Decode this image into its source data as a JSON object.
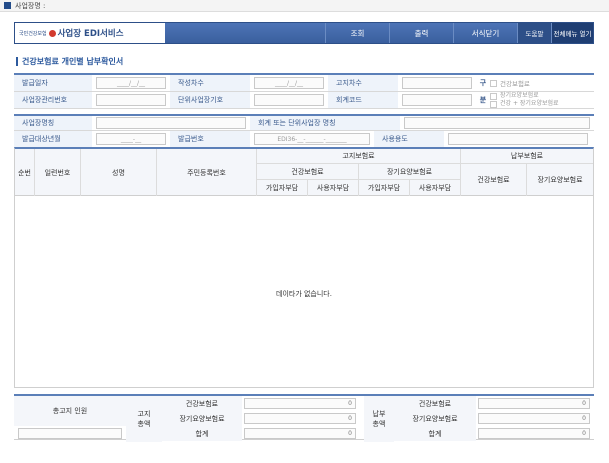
{
  "topbar": {
    "label": "사업장명 :"
  },
  "brand": {
    "org": "국민건강보험",
    "title": "사업장 EDI서비스"
  },
  "nav": {
    "query": "조회",
    "print": "출력",
    "close": "서식닫기",
    "help": "도움말",
    "allmenu": "전체메뉴 열기"
  },
  "page": {
    "title": "건강보험료 개인별 납부확인서"
  },
  "form": {
    "issue_date_label": "발급일자",
    "issue_date_value": "____/__/__",
    "write_count_label": "작성차수",
    "write_count_value": "____/__/__",
    "notice_count_label": "고지차수",
    "gu_label": "구",
    "bun_label": "분",
    "opt_health": "건강보험료",
    "opt_longterm": "장기요양보험료",
    "opt_both": "건강 + 장기요양보험료",
    "mgmt_no_label": "사업장관리번호",
    "unit_mgmt_label": "단위사업장기호",
    "acct_code_label": "회계코드",
    "biz_name_label": "사업장명칭",
    "acct_unit_label": "회계 또는 단위사업장 명칭",
    "target_year_label": "발급대상년월",
    "target_year_value": "____-__",
    "issue_no_label": "발급번호",
    "issue_no_value": "EDI36-__-______-_______",
    "usage_label": "사용용도"
  },
  "grid": {
    "col_no": "순번",
    "col_serial": "일련번호",
    "col_name": "성명",
    "col_rrn": "주민등록번호",
    "group_notice": "고지보험료",
    "group_paid": "납부보험료",
    "sub_health": "건강보험료",
    "sub_longterm": "장기요양보험료",
    "sub_subscriber": "가입자부담",
    "sub_employer": "사용자부담",
    "paid_health": "건강보험료",
    "paid_longterm": "장기요양보험료",
    "empty_message": "데이타가 없습니다."
  },
  "summary": {
    "total_notice_label": "총고지 인원",
    "notice_total_label_1": "고지",
    "notice_total_label_2": "총액",
    "paid_total_label_1": "납부",
    "paid_total_label_2": "총액",
    "row_health": "건강보험료",
    "row_longterm": "장기요양보험료",
    "row_sum": "합계",
    "notice_health": "0",
    "notice_longterm": "0",
    "notice_sum": "0",
    "paid_health": "0",
    "paid_longterm": "0",
    "paid_sum": "0"
  }
}
